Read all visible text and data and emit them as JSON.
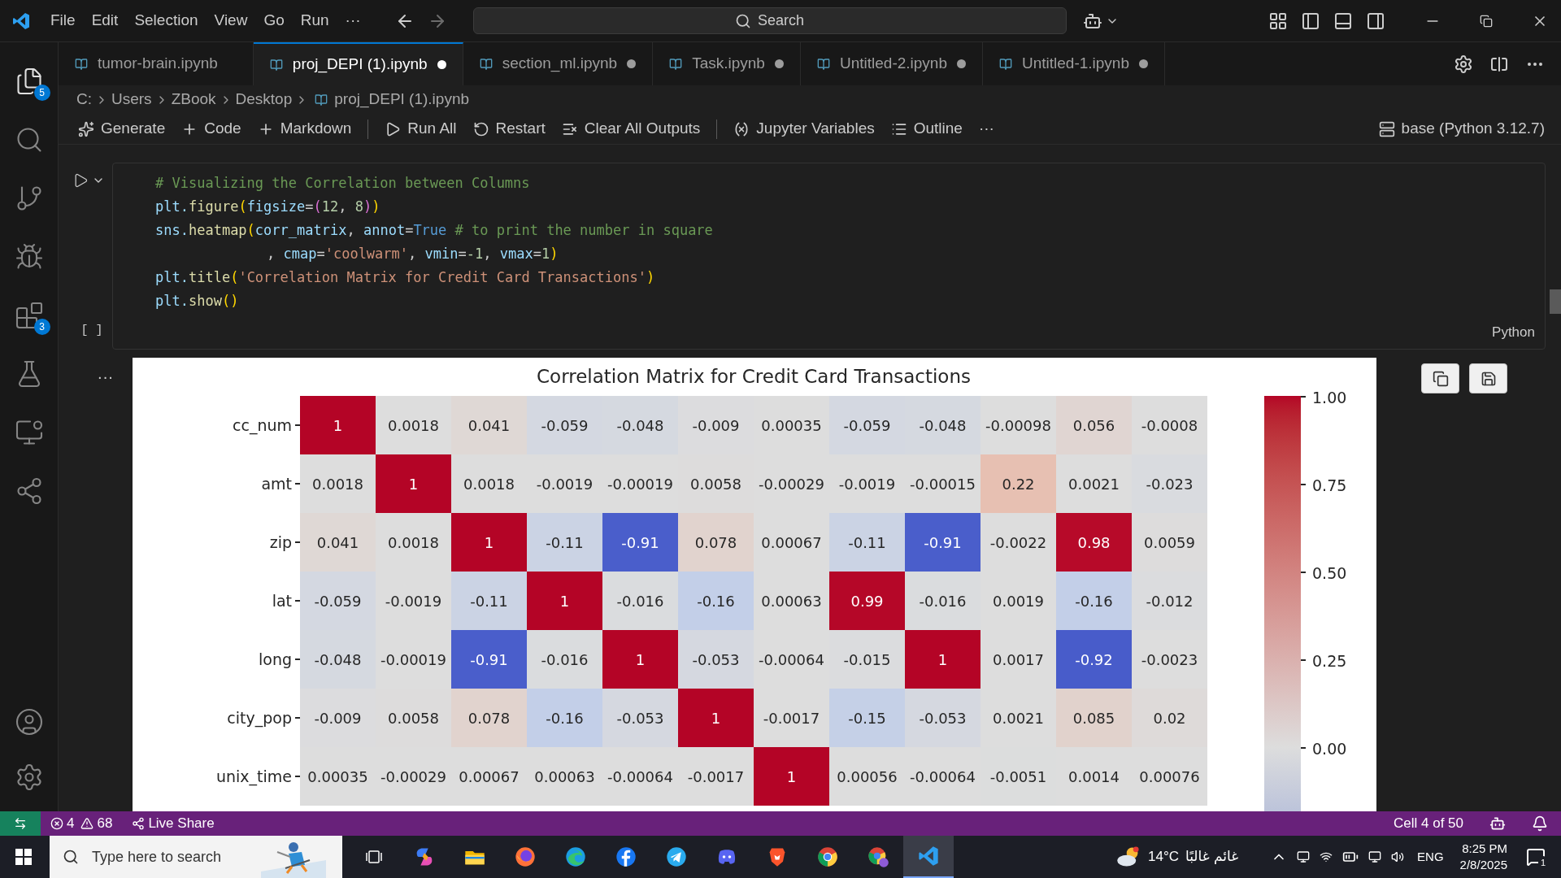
{
  "title_bar": {
    "menu": [
      "File",
      "Edit",
      "Selection",
      "View",
      "Go",
      "Run",
      "···"
    ],
    "search": "Search"
  },
  "activity_bar": {
    "items": [
      {
        "kind": "files",
        "badge": "5",
        "selected": true
      },
      {
        "kind": "search",
        "selected": false
      },
      {
        "kind": "source-control",
        "selected": false
      },
      {
        "kind": "run-debug",
        "selected": false
      },
      {
        "kind": "extensions",
        "badge": "3",
        "selected": false
      },
      {
        "kind": "testing",
        "selected": false
      },
      {
        "kind": "remote",
        "selected": false
      },
      {
        "kind": "live-share",
        "selected": false
      }
    ],
    "bottom": [
      {
        "kind": "account"
      },
      {
        "kind": "settings"
      }
    ]
  },
  "tabs": [
    {
      "label": "tumor-brain.ipynb",
      "selected": false,
      "modified": false
    },
    {
      "label": "proj_DEPI (1).ipynb",
      "selected": true,
      "modified": true
    },
    {
      "label": "section_ml.ipynb",
      "selected": false,
      "modified": true
    },
    {
      "label": "Task.ipynb",
      "selected": false,
      "modified": true
    },
    {
      "label": "Untitled-2.ipynb",
      "selected": false,
      "modified": true
    },
    {
      "label": "Untitled-1.ipynb",
      "selected": false,
      "modified": true
    }
  ],
  "breadcrumb": [
    "C:",
    "Users",
    "ZBook",
    "Desktop",
    "proj_DEPI (1).ipynb"
  ],
  "toolbar": {
    "items": [
      {
        "kind": "generate",
        "label": "Generate"
      },
      {
        "kind": "code",
        "label": "Code"
      },
      {
        "kind": "markdown",
        "label": "Markdown"
      },
      {
        "kind": "separator"
      },
      {
        "kind": "run-all",
        "label": "Run All"
      },
      {
        "kind": "restart",
        "label": "Restart"
      },
      {
        "kind": "clear",
        "label": "Clear All Outputs"
      },
      {
        "kind": "separator"
      },
      {
        "kind": "variables",
        "label": "Jupyter Variables"
      },
      {
        "kind": "outline",
        "label": "Outline"
      },
      {
        "kind": "more",
        "label": "···"
      }
    ],
    "kernel": "base (Python 3.12.7)"
  },
  "cell": {
    "execution_count": "[ ]",
    "language": "Python",
    "lines": [
      {
        "indent": false,
        "tokens": [
          {
            "text": "# Visualizing the Correlation between Columns",
            "kind": "comment"
          }
        ]
      },
      {
        "indent": false,
        "tokens": [
          {
            "text": "plt.",
            "kind": "var"
          },
          {
            "text": "figure",
            "kind": "func"
          },
          {
            "text": "(",
            "kind": "paren"
          },
          {
            "text": "figsize",
            "kind": "var"
          },
          {
            "text": "=",
            "kind": "plain"
          },
          {
            "text": "(",
            "kind": "paren2"
          },
          {
            "text": "12",
            "kind": "number"
          },
          {
            "text": ", ",
            "kind": "plain"
          },
          {
            "text": "8",
            "kind": "number"
          },
          {
            "text": ")",
            "kind": "paren2"
          },
          {
            "text": ")",
            "kind": "paren"
          }
        ]
      },
      {
        "indent": false,
        "tokens": [
          {
            "text": "sns.",
            "kind": "var"
          },
          {
            "text": "heatmap",
            "kind": "func"
          },
          {
            "text": "(",
            "kind": "paren"
          },
          {
            "text": "corr_matrix",
            "kind": "var"
          },
          {
            "text": ", ",
            "kind": "plain"
          },
          {
            "text": "annot",
            "kind": "var"
          },
          {
            "text": "=",
            "kind": "plain"
          },
          {
            "text": "True",
            "kind": "keyword"
          },
          {
            "text": " # to print the number in square",
            "kind": "comment"
          }
        ]
      },
      {
        "indent": true,
        "tokens": [
          {
            "text": ", ",
            "kind": "plain"
          },
          {
            "text": "cmap",
            "kind": "var"
          },
          {
            "text": "=",
            "kind": "plain"
          },
          {
            "text": "'coolwarm'",
            "kind": "string"
          },
          {
            "text": ", ",
            "kind": "plain"
          },
          {
            "text": "vmin",
            "kind": "var"
          },
          {
            "text": "=",
            "kind": "plain"
          },
          {
            "text": "-1",
            "kind": "number"
          },
          {
            "text": ", ",
            "kind": "plain"
          },
          {
            "text": "vmax",
            "kind": "var"
          },
          {
            "text": "=",
            "kind": "plain"
          },
          {
            "text": "1",
            "kind": "number"
          },
          {
            "text": ")",
            "kind": "paren"
          }
        ]
      },
      {
        "indent": false,
        "tokens": [
          {
            "text": "plt.",
            "kind": "var"
          },
          {
            "text": "title",
            "kind": "func"
          },
          {
            "text": "(",
            "kind": "paren"
          },
          {
            "text": "'Correlation Matrix for Credit Card Transactions'",
            "kind": "string"
          },
          {
            "text": ")",
            "kind": "paren"
          }
        ]
      },
      {
        "indent": false,
        "tokens": [
          {
            "text": "plt.",
            "kind": "var"
          },
          {
            "text": "show",
            "kind": "func"
          },
          {
            "text": "()",
            "kind": "paren"
          }
        ]
      }
    ]
  },
  "output": {
    "more": "···",
    "heatmap": {
      "title": "Correlation Matrix for Credit Card Transactions",
      "rows": [
        {
          "label": "cc_num",
          "cells": [
            "1",
            "0.0018",
            "0.041",
            "-0.059",
            "-0.048",
            "-0.009",
            "0.00035",
            "-0.059",
            "-0.048",
            "-0.00098",
            "0.056",
            "-0.0008"
          ]
        },
        {
          "label": "amt",
          "cells": [
            "0.0018",
            "1",
            "0.0018",
            "-0.0019",
            "-0.00019",
            "0.0058",
            "-0.00029",
            "-0.0019",
            "-0.00015",
            "0.22",
            "0.0021",
            "-0.023"
          ]
        },
        {
          "label": "zip",
          "cells": [
            "0.041",
            "0.0018",
            "1",
            "-0.11",
            "-0.91",
            "0.078",
            "0.00067",
            "-0.11",
            "-0.91",
            "-0.0022",
            "0.98",
            "0.0059"
          ]
        },
        {
          "label": "lat",
          "cells": [
            "-0.059",
            "-0.0019",
            "-0.11",
            "1",
            "-0.016",
            "-0.16",
            "0.00063",
            "0.99",
            "-0.016",
            "0.0019",
            "-0.16",
            "-0.012"
          ]
        },
        {
          "label": "long",
          "cells": [
            "-0.048",
            "-0.00019",
            "-0.91",
            "-0.016",
            "1",
            "-0.053",
            "-0.00064",
            "-0.015",
            "1",
            "0.0017",
            "-0.92",
            "-0.0023"
          ]
        },
        {
          "label": "city_pop",
          "cells": [
            "-0.009",
            "0.0058",
            "0.078",
            "-0.16",
            "-0.053",
            "1",
            "-0.0017",
            "-0.15",
            "-0.053",
            "0.0021",
            "0.085",
            "0.02"
          ]
        },
        {
          "label": "unix_time",
          "cells": [
            "0.00035",
            "-0.00029",
            "0.00067",
            "0.00063",
            "-0.00064",
            "-0.0017",
            "1",
            "0.00056",
            "-0.00064",
            "-0.0051",
            "0.0014",
            "0.00076"
          ]
        }
      ],
      "colorbar_ticks": [
        "1.00",
        "0.75",
        "0.50",
        "0.25",
        "0.00"
      ]
    }
  },
  "status_bar": {
    "errors": "4",
    "warnings": "68",
    "live_share": "Live Share",
    "cell_position": "Cell 4 of 50"
  },
  "taskbar": {
    "search_placeholder": "Type here to search",
    "apps": [
      {
        "kind": "task-view",
        "selected": false
      },
      {
        "kind": "copilot",
        "selected": false
      },
      {
        "kind": "explorer",
        "selected": false
      },
      {
        "kind": "firefox",
        "selected": false
      },
      {
        "kind": "edge",
        "selected": false
      },
      {
        "kind": "facebook",
        "selected": false
      },
      {
        "kind": "telegram",
        "selected": false
      },
      {
        "kind": "discord",
        "selected": false
      },
      {
        "kind": "brave",
        "selected": false
      },
      {
        "kind": "chrome",
        "selected": false
      },
      {
        "kind": "chrome-profile",
        "selected": false
      },
      {
        "kind": "vscode",
        "selected": true
      }
    ],
    "weather": {
      "temperature": "14°C",
      "condition": "غائم غالبًا"
    },
    "language": "ENG",
    "time": "8:25 PM",
    "date": "2/8/2025",
    "notifications": "1"
  }
}
